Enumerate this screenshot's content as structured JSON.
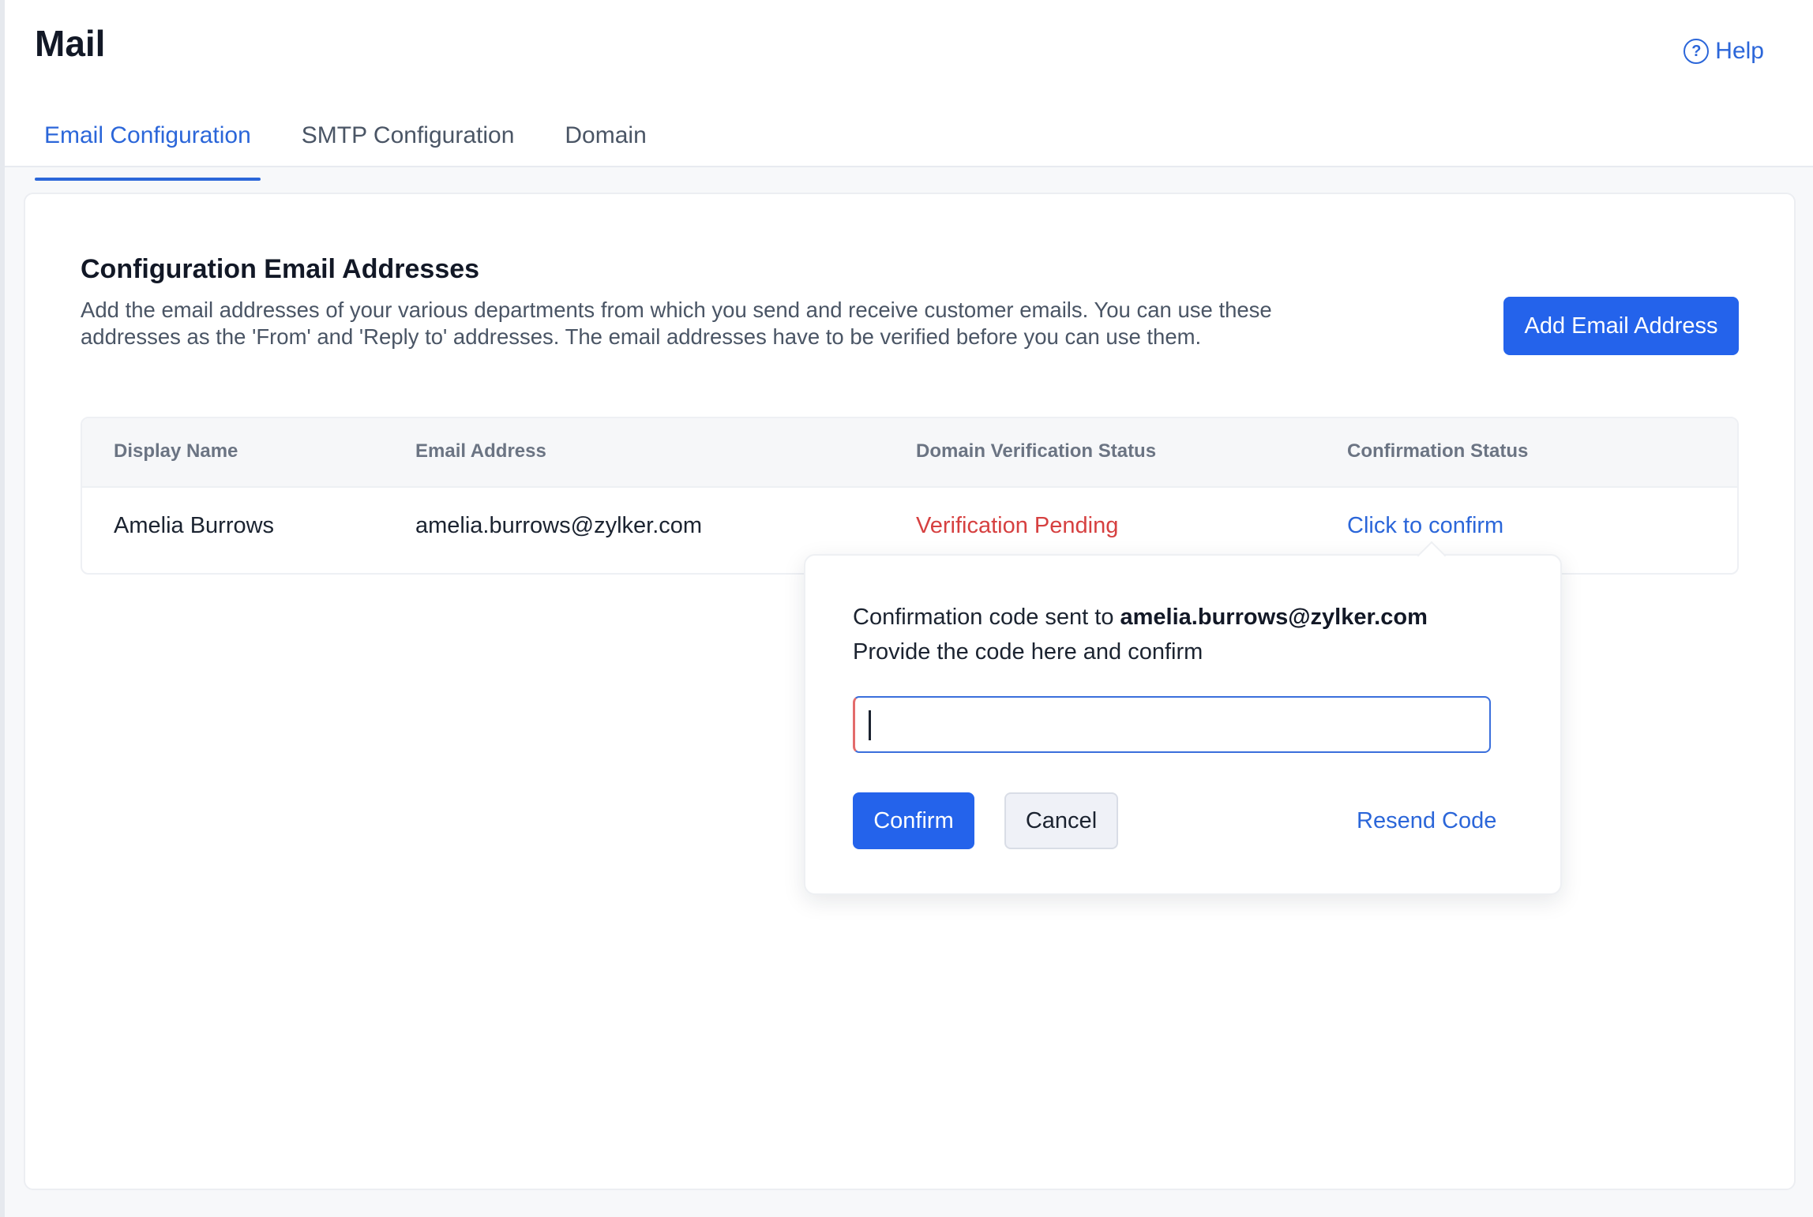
{
  "header": {
    "title": "Mail",
    "help_label": "Help",
    "help_icon": "help-circle-icon"
  },
  "tabs": [
    {
      "label": "Email Configuration",
      "active": true
    },
    {
      "label": "SMTP Configuration",
      "active": false
    },
    {
      "label": "Domain",
      "active": false
    }
  ],
  "section": {
    "title": "Configuration Email Addresses",
    "description": "Add the email addresses of your various departments from which you send and receive customer emails. You can use these addresses as the 'From' and 'Reply to' addresses. The email addresses have to be verified before you can use them.",
    "add_button": "Add Email Address"
  },
  "table": {
    "columns": [
      "Display Name",
      "Email Address",
      "Domain Verification Status",
      "Confirmation Status"
    ],
    "rows": [
      {
        "display_name": "Amelia Burrows",
        "email": "amelia.burrows@zylker.com",
        "domain_status": "Verification Pending",
        "confirmation_status": "Click to confirm"
      }
    ]
  },
  "popover": {
    "sent_prefix": "Confirmation code sent to ",
    "sent_email": "amelia.burrows@zylker.com",
    "instruction": "Provide the code here and confirm",
    "code_value": "",
    "confirm_label": "Confirm",
    "cancel_label": "Cancel",
    "resend_label": "Resend Code"
  },
  "colors": {
    "accent": "#2463eb",
    "link": "#2b66d9",
    "pending": "#d64040"
  }
}
